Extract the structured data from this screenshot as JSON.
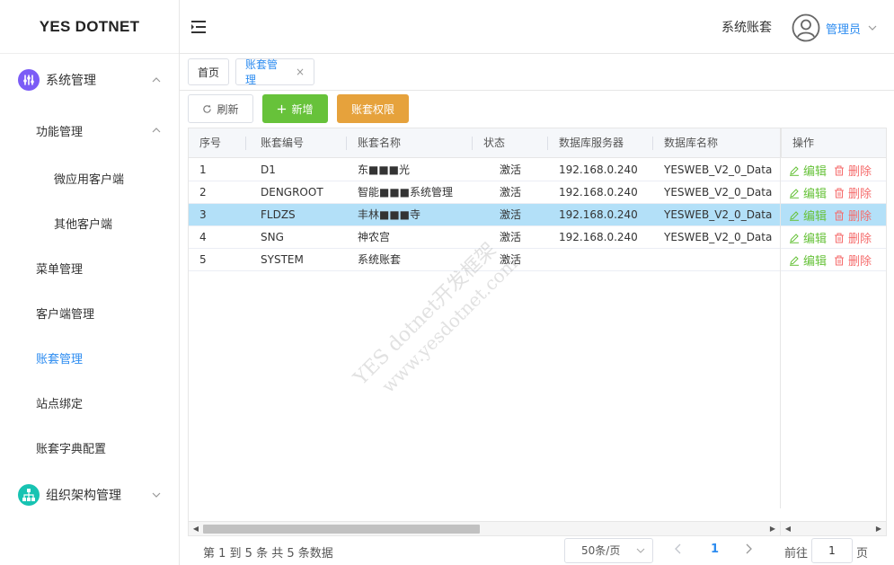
{
  "app": {
    "logo": "YES DOTNET"
  },
  "header": {
    "account_label": "系统账套",
    "user_name": "管理员"
  },
  "icons": {
    "fold": "menu-fold-icon",
    "avatar": "user-avatar-icon",
    "refresh": "refresh-icon",
    "add": "plus-icon",
    "edit": "edit-icon",
    "delete": "trash-icon"
  },
  "colors": {
    "primary": "#2d8cf0",
    "success": "#67c23a",
    "warning": "#e6a23c",
    "danger": "#f56c6c",
    "highlight_row": "#b3e0f8",
    "group1_icon": "#7b5cf6",
    "group2_icon": "#17c3b2"
  },
  "sidebar": {
    "groups": [
      {
        "label": "系统管理",
        "icon": "sliders-icon",
        "expanded": true
      },
      {
        "label": "组织架构管理",
        "icon": "org-chart-icon",
        "expanded": false
      }
    ],
    "items": [
      {
        "label": "功能管理",
        "level": 2,
        "expandable": true
      },
      {
        "label": "微应用客户端",
        "level": 3
      },
      {
        "label": "其他客户端",
        "level": 3
      },
      {
        "label": "菜单管理",
        "level": 2
      },
      {
        "label": "客户端管理",
        "level": 2
      },
      {
        "label": "账套管理",
        "level": 2,
        "active": true
      },
      {
        "label": "站点绑定",
        "level": 2
      },
      {
        "label": "账套字典配置",
        "level": 2
      }
    ]
  },
  "tabs": [
    {
      "label": "首页"
    },
    {
      "label": "账套管理",
      "active": true,
      "close": "×"
    }
  ],
  "toolbar": {
    "refresh": "刷新",
    "add": "新增",
    "permission": "账套权限"
  },
  "table": {
    "columns": [
      "序号",
      "账套编号",
      "账套名称",
      "状态",
      "数据库服务器",
      "数据库名称",
      "操作"
    ],
    "rows": [
      {
        "no": "1",
        "code": "D1",
        "name": "东■■■光",
        "status": "激活",
        "server": "192.168.0.240",
        "db": "YESWEB_V2_0_Data"
      },
      {
        "no": "2",
        "code": "DENGROOT",
        "name": "智能■■■系统管理",
        "status": "激活",
        "server": "192.168.0.240",
        "db": "YESWEB_V2_0_Data"
      },
      {
        "no": "3",
        "code": "FLDZS",
        "name": "丰林■■■寺",
        "status": "激活",
        "server": "192.168.0.240",
        "db": "YESWEB_V2_0_Data",
        "highlight": true
      },
      {
        "no": "4",
        "code": "SNG",
        "name": "神农宫",
        "status": "激活",
        "server": "192.168.0.240",
        "db": "YESWEB_V2_0_Data"
      },
      {
        "no": "5",
        "code": "SYSTEM",
        "name": "系统账套",
        "status": "激活",
        "server": "",
        "db": ""
      }
    ],
    "actions": {
      "edit": "编辑",
      "delete": "删除"
    }
  },
  "pagination": {
    "total_text": "第 1 到 5 条 共 5 条数据",
    "page_size": "50条/页",
    "current_page": "1",
    "goto_prefix": "前往",
    "goto_value": "1",
    "goto_suffix": "页"
  },
  "watermark": [
    "YES dotnet开发框架",
    "www.yesdotnet.com"
  ]
}
